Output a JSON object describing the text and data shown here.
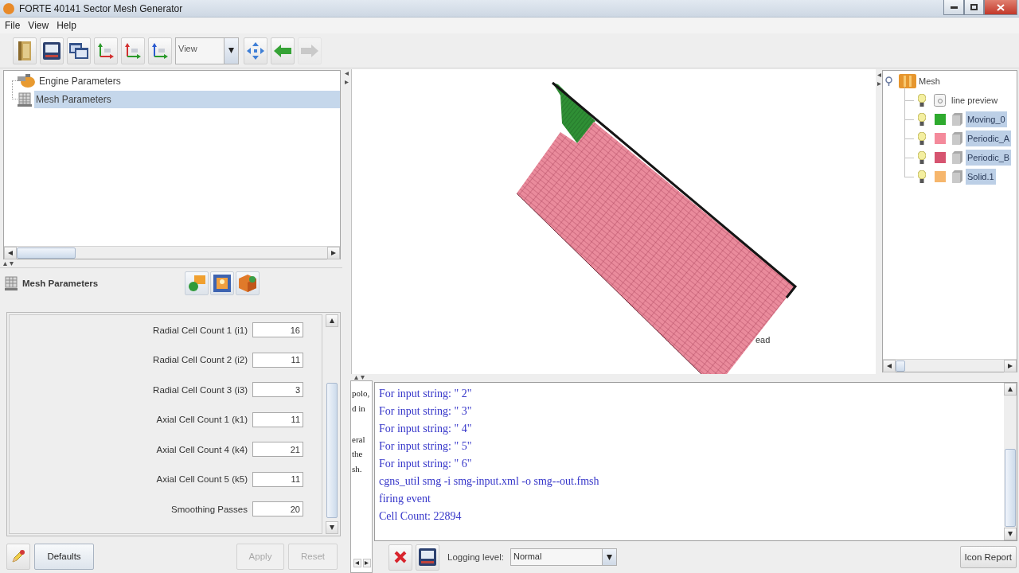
{
  "window": {
    "title": "FORTE 40141 Sector Mesh Generator"
  },
  "menu": [
    {
      "label": "File"
    },
    {
      "label": "View"
    },
    {
      "label": "Help"
    }
  ],
  "toolbar": {
    "buttons_left": [
      {
        "disabled": false
      },
      {
        "disabled": false
      },
      {
        "disabled": false
      },
      {
        "disabled": false
      },
      {
        "disabled": false
      },
      {
        "disabled": false
      }
    ],
    "view_select": {
      "value": "View"
    },
    "buttons_right": [
      {
        "disabled": false
      },
      {
        "disabled": false
      },
      {
        "disabled": true
      }
    ]
  },
  "nav_tree": {
    "items": [
      {
        "label": "Engine Parameters",
        "selected": false
      },
      {
        "label": "Mesh Parameters",
        "selected": true
      }
    ]
  },
  "mesh_parameters": {
    "title": "Mesh Parameters",
    "fields": [
      {
        "label": "Radial Cell Count 1 (i1)",
        "value": "16"
      },
      {
        "label": "Radial Cell Count 2 (i2)",
        "value": "11"
      },
      {
        "label": "Radial Cell Count 3 (i3)",
        "value": "3"
      },
      {
        "label": "Axial Cell Count 1 (k1)",
        "value": "11"
      },
      {
        "label": "Axial Cell Count 4 (k4)",
        "value": "21"
      },
      {
        "label": "Axial Cell Count 5 (k5)",
        "value": "11"
      },
      {
        "label": "Smoothing Passes",
        "value": "20"
      }
    ],
    "buttons": [
      {
        "label": "Defaults",
        "disabled": false
      },
      {
        "label": "Apply",
        "disabled": true
      },
      {
        "label": "Reset",
        "disabled": true
      }
    ]
  },
  "viewport": {
    "label": "ead"
  },
  "mesh_tree": {
    "root": {
      "label": "Mesh",
      "expanded": true,
      "children": [
        {
          "kind": "preview",
          "label": "line preview",
          "selected": false
        },
        {
          "kind": "part",
          "label": "Moving_0",
          "selected": true,
          "color": "#2eaa2e"
        },
        {
          "kind": "part",
          "label": "Periodic_A",
          "selected": true,
          "color": "#f48a9b"
        },
        {
          "kind": "part",
          "label": "Periodic_B",
          "selected": true,
          "color": "#d65470"
        },
        {
          "kind": "part",
          "label": "Solid.1",
          "selected": true,
          "color": "#f6b66c"
        }
      ]
    }
  },
  "side_text": {
    "paragraphs": [
      [
        "polo,",
        "d in"
      ],
      [
        "eral",
        "the",
        "sh."
      ]
    ]
  },
  "log": {
    "lines": [
      "For input string: \" 2\"",
      "For input string: \" 3\"",
      "For input string: \" 4\"",
      "For input string: \" 5\"",
      "For input string: \" 6\"",
      "cgns_util smg -i smg-input.xml -o smg--out.fmsh",
      "firing event",
      "Cell Count: 22894"
    ],
    "logging_label": "Logging level:",
    "logging_level": {
      "value": "Normal"
    },
    "buttons": [
      {
        "label": "Icon Report"
      }
    ]
  }
}
